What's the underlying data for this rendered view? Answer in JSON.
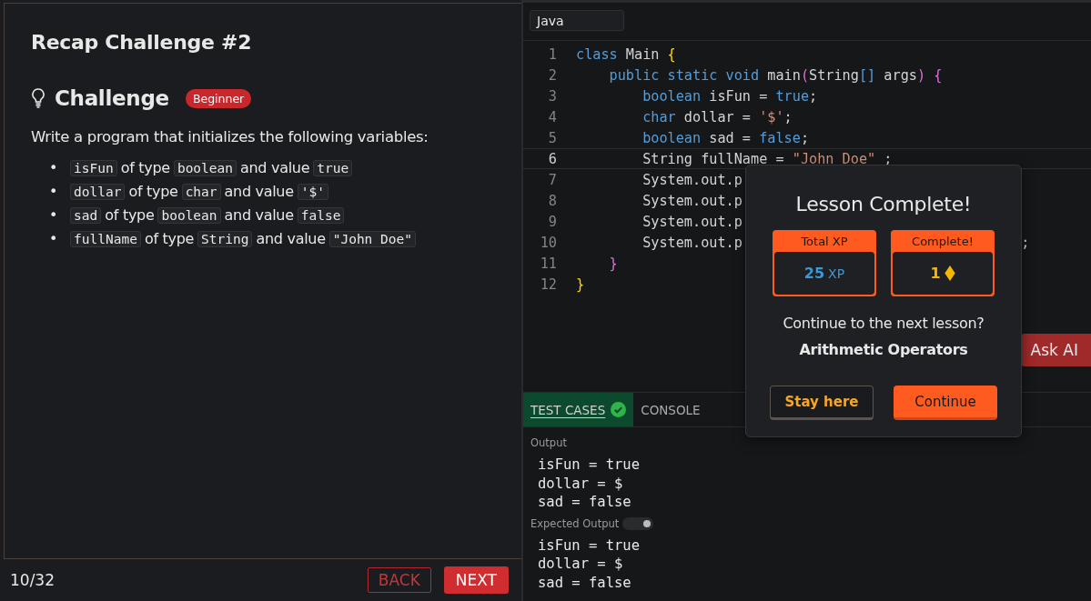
{
  "lesson": {
    "title": "Recap Challenge #2",
    "heading": "Challenge",
    "badge": "Beginner",
    "intro": "Write a program that initializes the following variables:",
    "items": [
      {
        "marker": "•",
        "parts": [
          {
            "kind": "code",
            "text": "isFun"
          },
          {
            "kind": "text",
            "text": "of type"
          },
          {
            "kind": "code",
            "text": "boolean"
          },
          {
            "kind": "text",
            "text": "and value"
          },
          {
            "kind": "code",
            "text": "true"
          }
        ]
      },
      {
        "marker": "•",
        "parts": [
          {
            "kind": "code",
            "text": "dollar"
          },
          {
            "kind": "text",
            "text": "of type"
          },
          {
            "kind": "code",
            "text": "char"
          },
          {
            "kind": "text",
            "text": "and value"
          },
          {
            "kind": "code",
            "text": "'$'"
          }
        ]
      },
      {
        "marker": "•",
        "parts": [
          {
            "kind": "code",
            "text": "sad"
          },
          {
            "kind": "text",
            "text": "of type"
          },
          {
            "kind": "code",
            "text": "boolean"
          },
          {
            "kind": "text",
            "text": "and value"
          },
          {
            "kind": "code",
            "text": "false"
          }
        ]
      },
      {
        "marker": "•",
        "parts": [
          {
            "kind": "code",
            "text": "fullName"
          },
          {
            "kind": "text",
            "text": "of type"
          },
          {
            "kind": "code",
            "text": "String"
          },
          {
            "kind": "text",
            "text": "and value"
          },
          {
            "kind": "code",
            "text": "\"John Doe\""
          }
        ]
      }
    ]
  },
  "footer": {
    "progress": "10/32",
    "back": "BACK",
    "next": "NEXT"
  },
  "editor": {
    "language": "Java",
    "lines": [
      {
        "number": "1",
        "current": false,
        "tokens": [
          {
            "kind": "keyword",
            "text": "class"
          },
          {
            "kind": "plain",
            "text": " Main "
          },
          {
            "kind": "open",
            "text": "{",
            "color": "#ffd700"
          }
        ]
      },
      {
        "number": "2",
        "current": false,
        "tokens": [
          {
            "kind": "keyword",
            "text": "public static void"
          },
          {
            "kind": "plain",
            "text": " main"
          },
          {
            "kind": "paren",
            "text": "("
          },
          {
            "kind": "plain",
            "text": "String"
          },
          {
            "kind": "keyword",
            "text": "[]"
          },
          {
            "kind": "plain",
            "text": " args"
          },
          {
            "kind": "paren",
            "text": ")"
          },
          {
            "kind": "open",
            "text": " {",
            "color": "#da70d6"
          }
        ]
      },
      {
        "number": "3",
        "current": false,
        "tokens": [
          {
            "kind": "keyword",
            "text": "boolean"
          },
          {
            "kind": "plain",
            "text": " isFun = "
          },
          {
            "kind": "keyword",
            "text": "true"
          },
          {
            "kind": "plain",
            "text": ";"
          }
        ]
      },
      {
        "number": "4",
        "current": false,
        "tokens": [
          {
            "kind": "keyword",
            "text": "char"
          },
          {
            "kind": "plain",
            "text": " dollar = "
          },
          {
            "kind": "string",
            "text": "'$'"
          },
          {
            "kind": "plain",
            "text": ";"
          }
        ]
      },
      {
        "number": "5",
        "current": false,
        "tokens": [
          {
            "kind": "keyword",
            "text": "boolean"
          },
          {
            "kind": "plain",
            "text": " sad = "
          },
          {
            "kind": "keyword",
            "text": "false"
          },
          {
            "kind": "plain",
            "text": ";"
          }
        ]
      },
      {
        "number": "6",
        "current": true,
        "tokens": [
          {
            "kind": "plain",
            "text": "String fullName = "
          },
          {
            "kind": "string",
            "text": "\"John Doe\""
          },
          {
            "kind": "plain",
            "text": " ;"
          }
        ]
      },
      {
        "number": "7",
        "current": false,
        "tokens": [
          {
            "kind": "plain",
            "text": "System.out.p"
          }
        ]
      },
      {
        "number": "8",
        "current": false,
        "tokens": [
          {
            "kind": "plain",
            "text": "System.out.p"
          }
        ]
      },
      {
        "number": "9",
        "current": false,
        "tokens": [
          {
            "kind": "plain",
            "text": "System.out.p"
          }
        ]
      },
      {
        "number": "10",
        "current": false,
        "tokens": [
          {
            "kind": "plain",
            "text": "System.out.p"
          },
          {
            "kind": "tail",
            "text": ";"
          }
        ]
      },
      {
        "number": "11",
        "current": false,
        "tokens": [
          {
            "kind": "close",
            "text": "}",
            "color": "#da70d6"
          }
        ]
      },
      {
        "number": "12",
        "current": false,
        "tokens": [
          {
            "kind": "close",
            "text": "}",
            "color": "#ffd700"
          }
        ]
      }
    ]
  },
  "ask_ai": "Ask AI",
  "tabs": [
    {
      "label": "TEST CASES",
      "selected": true,
      "passed": true
    },
    {
      "label": "CONSOLE",
      "selected": false,
      "passed": false
    }
  ],
  "output": {
    "label": "Output",
    "lines": [
      "isFun = true",
      "dollar = $",
      "sad = false"
    ]
  },
  "expected": {
    "label": "Expected Output",
    "toggle_on": true,
    "lines": [
      "isFun = true",
      "dollar = $",
      "sad = false"
    ]
  },
  "dialog": {
    "title": "Lesson Complete!",
    "stats": [
      {
        "kind": "xp",
        "label": "Total XP",
        "value": "25",
        "unit": "XP"
      },
      {
        "kind": "gems",
        "label": "Complete!",
        "value": "1"
      }
    ],
    "question": "Continue to the next lesson?",
    "next_lesson": "Arithmetic Operators",
    "stay": "Stay here",
    "continue": "Continue"
  }
}
